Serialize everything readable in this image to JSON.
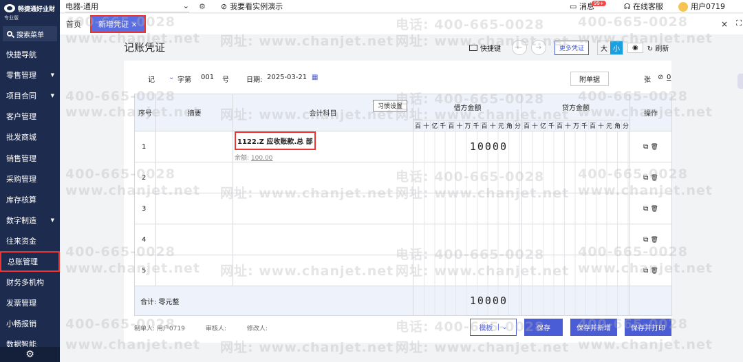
{
  "sidebar": {
    "brand": "畅捷通好业财",
    "edition": "专业版",
    "search_label": "搜索菜单",
    "items": [
      {
        "label": "快捷导航",
        "caret": false
      },
      {
        "label": "零售管理",
        "caret": true
      },
      {
        "label": "项目合同",
        "caret": true
      },
      {
        "label": "客户管理",
        "caret": false
      },
      {
        "label": "批发商城",
        "caret": false
      },
      {
        "label": "销售管理",
        "caret": false
      },
      {
        "label": "采购管理",
        "caret": false
      },
      {
        "label": "库存核算",
        "caret": false
      },
      {
        "label": "数字制造",
        "caret": true
      },
      {
        "label": "往来资金",
        "caret": false
      },
      {
        "label": "总账管理",
        "caret": false,
        "active": true
      },
      {
        "label": "财务多机构",
        "caret": false
      },
      {
        "label": "发票管理",
        "caret": false
      },
      {
        "label": "小畅报销",
        "caret": false
      },
      {
        "label": "数据智能",
        "caret": false
      }
    ]
  },
  "topbar": {
    "org": "电器-通用",
    "demo": "我要看实例演示",
    "messages": "消息",
    "badge": "99+",
    "support": "在线客服",
    "user": "用户0719"
  },
  "tabs": {
    "home": "首页",
    "active": "新增凭证"
  },
  "watermark": {
    "phone": "电话: 400-665-0028",
    "site": "网址: www.chanjet.net",
    "phone_short": "400-665-0028",
    "site_short": "www.chanjet.net"
  },
  "page": {
    "title": "记账凭证",
    "shortcut": "快捷键",
    "more": "更多凭证",
    "size_big": "大",
    "size_small": "小",
    "refresh": "刷新"
  },
  "header": {
    "type": "记",
    "word_no_label": "字第",
    "number": "001",
    "number_suffix": "号",
    "date_label": "日期:",
    "date": "2025-03-21",
    "attach_label": "附单据",
    "attach_unit": "张",
    "attach_count": "0"
  },
  "table": {
    "col_seq": "序号",
    "col_summary": "摘要",
    "col_account": "会计科目",
    "habit": "习惯设置",
    "col_debit": "借方金额",
    "col_credit": "贷方金额",
    "col_ops": "操作",
    "digits": [
      "百",
      "十",
      "亿",
      "千",
      "百",
      "十",
      "万",
      "千",
      "百",
      "十",
      "元",
      "角",
      "分"
    ],
    "rows": [
      {
        "seq": "1",
        "account": "1122.Z 应收账款.总 部",
        "balance_label": "余额:",
        "balance": "100.00",
        "debit": "10000"
      },
      {
        "seq": "2",
        "account": "",
        "debit": ""
      },
      {
        "seq": "3",
        "account": "",
        "debit": ""
      },
      {
        "seq": "4",
        "account": "",
        "debit": ""
      },
      {
        "seq": "5",
        "account": "",
        "debit": ""
      }
    ],
    "total_label": "合计: 零元整",
    "total_debit": "10000"
  },
  "footer": {
    "maker": "制单人: 用户0719",
    "reviewer": "审核人:",
    "modifier": "修改人:"
  },
  "buttons": {
    "template": "模板",
    "save": "保存",
    "save_new": "保存并新增",
    "save_print": "保存并打印"
  }
}
